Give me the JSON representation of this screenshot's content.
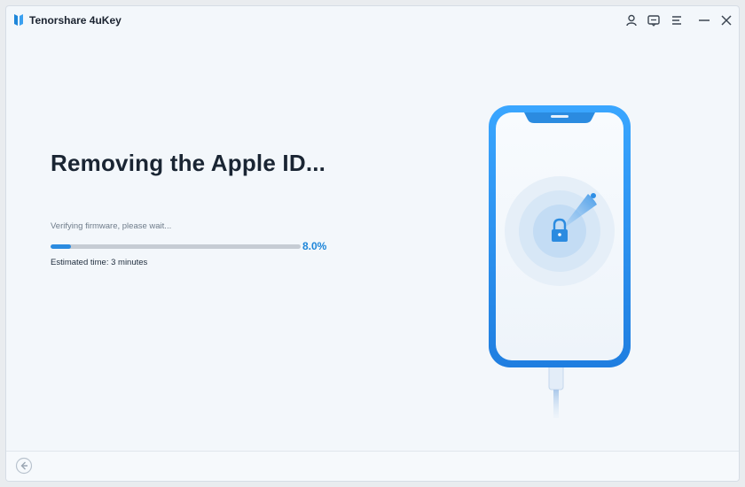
{
  "app": {
    "title": "Tenorshare 4uKey"
  },
  "titlebar": {
    "icons": [
      "user-icon",
      "feedback-icon",
      "menu-icon",
      "minimize-icon",
      "close-icon"
    ]
  },
  "main": {
    "heading": "Removing the Apple ID...",
    "status": "Verifying firmware, please wait...",
    "progress": {
      "percent_label": "8.0%",
      "fraction": 0.08
    },
    "eta": "Estimated time: 3 minutes"
  },
  "illustration": {
    "icons": [
      "phone-icon",
      "lock-icon",
      "cable-icon"
    ]
  },
  "footer": {
    "icons": [
      "back-arrow-icon"
    ]
  },
  "colors": {
    "accent": "#2b8be0",
    "phone_frame": "#2b8be0",
    "background": "#f3f7fb"
  }
}
